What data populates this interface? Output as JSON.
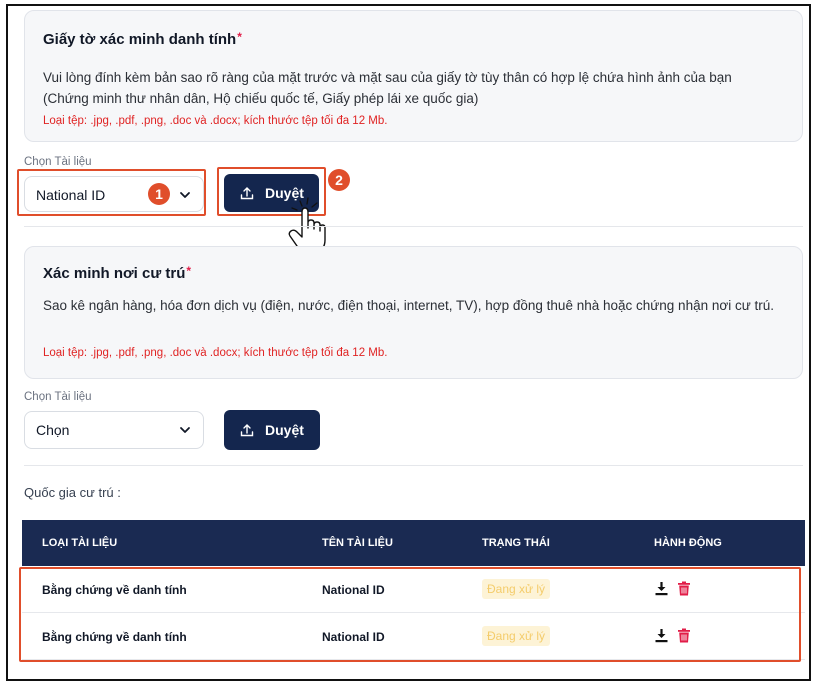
{
  "identity_section": {
    "title": "Giấy tờ xác minh danh tính",
    "required_mark": "*",
    "description": "Vui lòng đính kèm bản sao rõ ràng của mặt trước và mặt sau của giấy tờ tùy thân có hợp lệ chứa hình ảnh của bạn (Chứng minh thư nhân dân, Hộ chiếu quốc tế, Giấy phép lái xe quốc gia)",
    "file_note": "Loại tệp: .jpg, .pdf, .png, .doc và .docx; kích thước tệp tối đa 12 Mb.",
    "select_label": "Chọn Tài liệu",
    "select_value": "National ID",
    "browse_label": "Duyệt",
    "step_marker_1": "1",
    "step_marker_2": "2"
  },
  "residence_section": {
    "title": "Xác minh nơi cư trú",
    "required_mark": "*",
    "description": "Sao kê ngân hàng, hóa đơn dịch vụ (điện, nước, điện thoại, internet, TV), hợp đồng thuê nhà hoặc chứng nhận nơi cư trú.",
    "file_note": "Loại tệp: .jpg, .pdf, .png, .doc và .docx; kích thước tệp tối đa 12 Mb.",
    "select_label": "Chọn Tài liệu",
    "select_value": "Chọn",
    "browse_label": "Duyệt"
  },
  "country_label": "Quốc gia cư trú :",
  "table": {
    "headers": [
      "LOẠI TÀI LIỆU",
      "TÊN TÀI LIỆU",
      "TRẠNG THÁI",
      "HÀNH ĐỘNG"
    ],
    "rows": [
      {
        "type": "Bằng chứng về danh tính",
        "name": "National ID",
        "status": "Đang xử lý"
      },
      {
        "type": "Bằng chứng về danh tính",
        "name": "National ID",
        "status": "Đang xử lý"
      }
    ]
  },
  "colors": {
    "primary_navy": "#14264e",
    "highlight": "#e04e2b",
    "delete_red": "#e11d48",
    "status_bg": "#fdf3d6"
  },
  "icons": [
    "chevron-down-icon",
    "upload-icon",
    "hand-cursor-icon",
    "download-icon",
    "trash-icon"
  ]
}
